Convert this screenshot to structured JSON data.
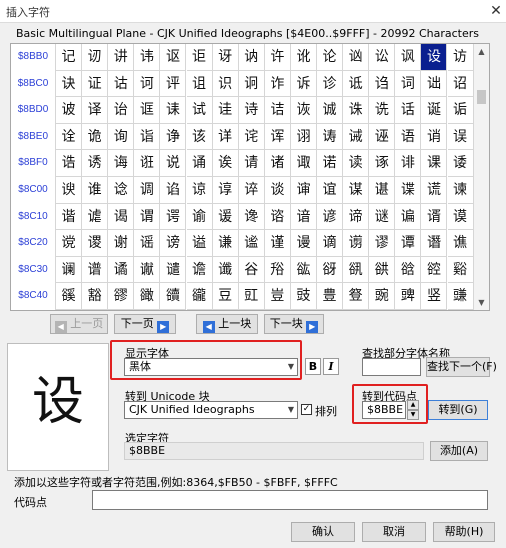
{
  "window": {
    "title": "插入字符",
    "close_glyph": "✕"
  },
  "range_title": "Basic Multilingual Plane - CJK Unified Ideographs [$4E00..$9FFF] - 20992 Characters",
  "grid": {
    "selected": "设",
    "rows": [
      {
        "label": "$8BB0",
        "chars": [
          "记",
          "讱",
          "讲",
          "讳",
          "讴",
          "讵",
          "讶",
          "讷",
          "许",
          "讹",
          "论",
          "讻",
          "讼",
          "讽",
          "设",
          "访"
        ]
      },
      {
        "label": "$8BC0",
        "chars": [
          "诀",
          "证",
          "诂",
          "诃",
          "评",
          "诅",
          "识",
          "诇",
          "诈",
          "诉",
          "诊",
          "诋",
          "诌",
          "词",
          "诎",
          "诏"
        ]
      },
      {
        "label": "$8BD0",
        "chars": [
          "诐",
          "译",
          "诒",
          "诓",
          "诔",
          "试",
          "诖",
          "诗",
          "诘",
          "诙",
          "诚",
          "诛",
          "诜",
          "话",
          "诞",
          "诟"
        ]
      },
      {
        "label": "$8BE0",
        "chars": [
          "诠",
          "诡",
          "询",
          "诣",
          "诤",
          "该",
          "详",
          "诧",
          "诨",
          "诩",
          "诪",
          "诫",
          "诬",
          "语",
          "诮",
          "误"
        ]
      },
      {
        "label": "$8BF0",
        "chars": [
          "诰",
          "诱",
          "诲",
          "诳",
          "说",
          "诵",
          "诶",
          "请",
          "诸",
          "诹",
          "诺",
          "读",
          "诼",
          "诽",
          "课",
          "诿"
        ]
      },
      {
        "label": "$8C00",
        "chars": [
          "谀",
          "谁",
          "谂",
          "调",
          "谄",
          "谅",
          "谆",
          "谇",
          "谈",
          "谉",
          "谊",
          "谋",
          "谌",
          "谍",
          "谎",
          "谏"
        ]
      },
      {
        "label": "$8C10",
        "chars": [
          "谐",
          "谑",
          "谒",
          "谓",
          "谔",
          "谕",
          "谖",
          "谗",
          "谘",
          "谙",
          "谚",
          "谛",
          "谜",
          "谝",
          "谞",
          "谟"
        ]
      },
      {
        "label": "$8C20",
        "chars": [
          "谠",
          "谡",
          "谢",
          "谣",
          "谤",
          "谥",
          "谦",
          "谧",
          "谨",
          "谩",
          "谪",
          "谫",
          "谬",
          "谭",
          "谮",
          "谯"
        ]
      },
      {
        "label": "$8C30",
        "chars": [
          "谰",
          "谱",
          "谲",
          "谳",
          "谴",
          "谵",
          "谶",
          "谷",
          "谸",
          "谹",
          "谺",
          "谻",
          "谼",
          "谽",
          "谾",
          "谿"
        ]
      },
      {
        "label": "$8C40",
        "chars": [
          "豀",
          "豁",
          "豂",
          "豃",
          "豄",
          "豅",
          "豆",
          "豇",
          "豈",
          "豉",
          "豊",
          "豋",
          "豌",
          "豍",
          "竖",
          "豏"
        ]
      }
    ]
  },
  "nav": {
    "prev_page": "上一页",
    "next_page": "下一页",
    "prev_block": "上一块",
    "next_block": "下一块"
  },
  "font": {
    "label": "显示字体",
    "value": "黑体",
    "bold": "B",
    "italic": "I"
  },
  "find_font": {
    "label": "查找部分字体名称",
    "value": "",
    "find_next": "查找下一个(F)"
  },
  "unicode_block": {
    "label": "转到 Unicode 块",
    "value": "CJK Unified Ideographs",
    "sort_label": "排列",
    "sort_checked": true,
    "check_glyph": "✓"
  },
  "goto_code": {
    "label": "转到代码点",
    "value": "$8BBE",
    "button": "转到(G)"
  },
  "selected_char": {
    "label": "选定字符",
    "value": "$8BBE",
    "add_button": "添加(A)"
  },
  "add_range": {
    "label": "添加以这些字符或者字符范围,例如:8364,$FB50 - $FBFF, $FFFC",
    "code_label": "代码点",
    "code_value": ""
  },
  "footer": {
    "ok": "确认",
    "cancel": "取消",
    "help": "帮助(H)"
  },
  "colors": {
    "selected_bg": "#0a1f8f",
    "row_label": "#2b3fd6",
    "highlight": "#e02020"
  }
}
